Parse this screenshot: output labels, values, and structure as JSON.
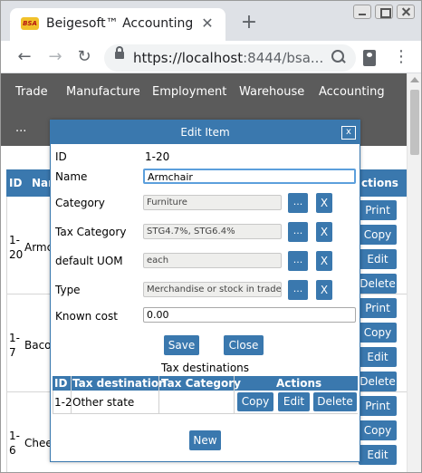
{
  "browser": {
    "tab_title": "Beigesoft™ Accounting",
    "tab_favicon": "BSA",
    "url_host": "https://localhost",
    "url_rest": ":8444/bsa...",
    "icons": {
      "back": "back-arrow-icon",
      "forward": "forward-arrow-icon",
      "reload": "reload-icon",
      "lock": "lock-icon",
      "zoom": "zoom-icon",
      "profile": "profile-icon",
      "menu": "menu-icon"
    }
  },
  "app_nav": {
    "items": [
      "Trade",
      "Manufacture",
      "Employment",
      "Warehouse",
      "Accounting",
      "..."
    ]
  },
  "background_table": {
    "headers": {
      "id": "ID",
      "name": "Nam",
      "actions": "ctions"
    },
    "rows": [
      {
        "id_top": "1-",
        "id_bottom": "20",
        "name": "Armc",
        "buttons": [
          "Print",
          "Copy",
          "Edit",
          "Delete"
        ]
      },
      {
        "id_top": "1-",
        "id_bottom": "7",
        "name": "Baco",
        "buttons": [
          "Print",
          "Copy",
          "Edit",
          "Delete"
        ]
      },
      {
        "id_top": "1-",
        "id_bottom": "6",
        "name": "Chee",
        "buttons": [
          "Print",
          "Copy",
          "Edit"
        ]
      }
    ]
  },
  "modal": {
    "title": "Edit Item",
    "close_label": "x",
    "fields": {
      "id": {
        "label": "ID",
        "value": "1-20"
      },
      "name": {
        "label": "Name",
        "value": "Armchair"
      },
      "category": {
        "label": "Category",
        "value": "Furniture"
      },
      "tax_category": {
        "label": "Tax Category",
        "value": "STG4.7%, STG6.4%"
      },
      "default_uom": {
        "label": "default UOM",
        "value": "each"
      },
      "type": {
        "label": "Type",
        "value": "Merchandise or stock in trade"
      },
      "known_cost": {
        "label": "Known cost",
        "value": "0.00"
      }
    },
    "pick_label": "...",
    "clear_label": "X",
    "save_label": "Save",
    "close_button_label": "Close",
    "tax_destinations": {
      "title": "Tax destinations",
      "headers": [
        "ID",
        "Tax destination",
        "Tax Category",
        "Actions"
      ],
      "rows": [
        {
          "id": "1-2",
          "destination": "Other state",
          "category": "",
          "actions": [
            "Copy",
            "Edit",
            "Delete"
          ]
        }
      ]
    },
    "new_label": "New"
  },
  "colors": {
    "accent": "#3a78ae",
    "nav_background": "#5b5b5b",
    "chrome_background": "#dee1e6"
  }
}
